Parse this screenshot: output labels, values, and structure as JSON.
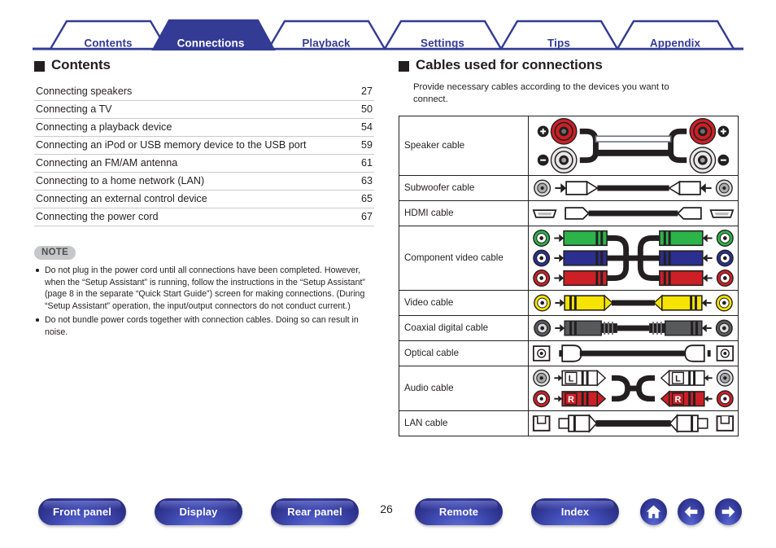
{
  "tabs": [
    {
      "label": "Contents",
      "active": false
    },
    {
      "label": "Connections",
      "active": true
    },
    {
      "label": "Playback",
      "active": false
    },
    {
      "label": "Settings",
      "active": false
    },
    {
      "label": "Tips",
      "active": false
    },
    {
      "label": "Appendix",
      "active": false
    }
  ],
  "left": {
    "heading": "Contents",
    "toc": [
      {
        "title": "Connecting speakers",
        "page": "27"
      },
      {
        "title": "Connecting a TV",
        "page": "50"
      },
      {
        "title": "Connecting a playback device",
        "page": "54"
      },
      {
        "title": "Connecting an iPod or USB memory device to the USB port",
        "page": "59"
      },
      {
        "title": "Connecting an FM/AM antenna",
        "page": "61"
      },
      {
        "title": "Connecting to a home network (LAN)",
        "page": "63"
      },
      {
        "title": "Connecting an external control device",
        "page": "65"
      },
      {
        "title": "Connecting the power cord",
        "page": "67"
      }
    ],
    "note": {
      "badge": "NOTE",
      "items": [
        "Do not plug in the power cord until all connections have been completed. However, when the “Setup Assistant” is running, follow the instructions in the “Setup Assistant” (page 8 in the separate “Quick Start Guide”) screen for making connections. (During “Setup Assistant” operation, the input/output connectors do not conduct current.)",
        "Do not bundle power cords together with connection cables. Doing so can result in noise."
      ]
    }
  },
  "right": {
    "heading": "Cables used for connections",
    "lead": "Provide necessary cables according to the devices you want to connect.",
    "cables": [
      {
        "name": "Speaker cable",
        "art": "speaker-cable"
      },
      {
        "name": "Subwoofer cable",
        "art": "subwoofer-cable"
      },
      {
        "name": "HDMI cable",
        "art": "hdmi-cable"
      },
      {
        "name": "Component video cable",
        "art": "component-video-cable"
      },
      {
        "name": "Video cable",
        "art": "video-cable"
      },
      {
        "name": "Coaxial digital cable",
        "art": "coaxial-digital-cable"
      },
      {
        "name": "Optical cable",
        "art": "optical-cable"
      },
      {
        "name": "Audio cable",
        "art": "audio-cable"
      },
      {
        "name": "LAN cable",
        "art": "lan-cable"
      }
    ]
  },
  "bottom": {
    "buttons": [
      {
        "label": "Front panel"
      },
      {
        "label": "Display"
      },
      {
        "label": "Rear panel"
      },
      {
        "label": "Remote"
      },
      {
        "label": "Index"
      }
    ],
    "page_number": "26",
    "icons": [
      "home-icon",
      "arrow-left-icon",
      "arrow-right-icon"
    ]
  },
  "colors": {
    "brand_blue": "#333b94",
    "accent_red": "#cc2026",
    "accent_green": "#2cb34a",
    "accent_blue": "#2b2f8f",
    "accent_yellow": "#f4e400",
    "note_gray": "#c6c7c9"
  }
}
